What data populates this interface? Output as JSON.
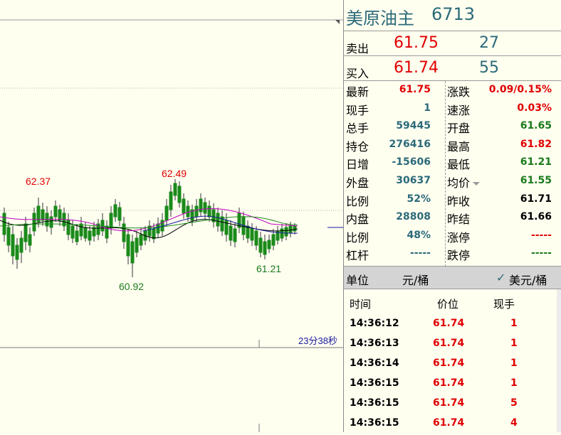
{
  "chart": {
    "price_labels": {
      "high1": "62.37",
      "high2": "62.49",
      "low1": "60.92",
      "low2": "61.21"
    },
    "countdown": "23分38秒"
  },
  "header": {
    "name": "美原油主",
    "code": "6713"
  },
  "quote": {
    "ask_label": "卖出",
    "ask_price": "61.75",
    "ask_vol": "27",
    "bid_label": "买入",
    "bid_price": "61.74",
    "bid_vol": "55"
  },
  "stats": {
    "left": [
      {
        "label": "最新",
        "value": "61.75",
        "color": "#e00000"
      },
      {
        "label": "现手",
        "value": "1",
        "color": "#2b6a7a"
      },
      {
        "label": "总手",
        "value": "59445",
        "color": "#2b6a7a"
      },
      {
        "label": "持仓",
        "value": "276416",
        "color": "#2b6a7a"
      },
      {
        "label": "日增",
        "value": "-15606",
        "color": "#2b6a7a"
      },
      {
        "label": "外盘",
        "value": "30637",
        "color": "#2b6a7a"
      },
      {
        "label": "比例",
        "value": "52%",
        "color": "#2b6a7a"
      },
      {
        "label": "内盘",
        "value": "28808",
        "color": "#2b6a7a"
      },
      {
        "label": "比例",
        "value": "48%",
        "color": "#2b6a7a"
      },
      {
        "label": "杠杆",
        "value": "-----",
        "color": "#2b6a7a"
      }
    ],
    "right": [
      {
        "label": "涨跌",
        "value": "0.09/0.15%",
        "color": "#e00000"
      },
      {
        "label": "速涨",
        "value": "0.03%",
        "color": "#e00000"
      },
      {
        "label": "开盘",
        "value": "61.65",
        "color": "#1a7a1a"
      },
      {
        "label": "最高",
        "value": "61.82",
        "color": "#e00000"
      },
      {
        "label": "最低",
        "value": "61.21",
        "color": "#1a7a1a"
      },
      {
        "label": "均价",
        "value": "61.55",
        "color": "#1a7a1a"
      },
      {
        "label": "昨收",
        "value": "61.71",
        "color": "#000000"
      },
      {
        "label": "昨结",
        "value": "61.66",
        "color": "#000000"
      },
      {
        "label": "涨停",
        "value": "-----",
        "color": "#e00000"
      },
      {
        "label": "跌停",
        "value": "-----",
        "color": "#1a7a1a"
      }
    ]
  },
  "unit_bar": {
    "label": "单位",
    "unit": "元/桶",
    "alt_unit": "美元/桶",
    "check": "✓"
  },
  "ticks": {
    "headers": {
      "time": "时间",
      "price": "价位",
      "vol": "现手"
    },
    "rows": [
      {
        "time": "14:36:12",
        "price": "61.74",
        "vol": "1"
      },
      {
        "time": "14:36:13",
        "price": "61.74",
        "vol": "1"
      },
      {
        "time": "14:36:14",
        "price": "61.74",
        "vol": "1"
      },
      {
        "time": "14:36:15",
        "price": "61.74",
        "vol": "1"
      },
      {
        "time": "14:36:15",
        "price": "61.74",
        "vol": "5"
      },
      {
        "time": "14:36:15",
        "price": "61.74",
        "vol": "4"
      }
    ]
  }
}
